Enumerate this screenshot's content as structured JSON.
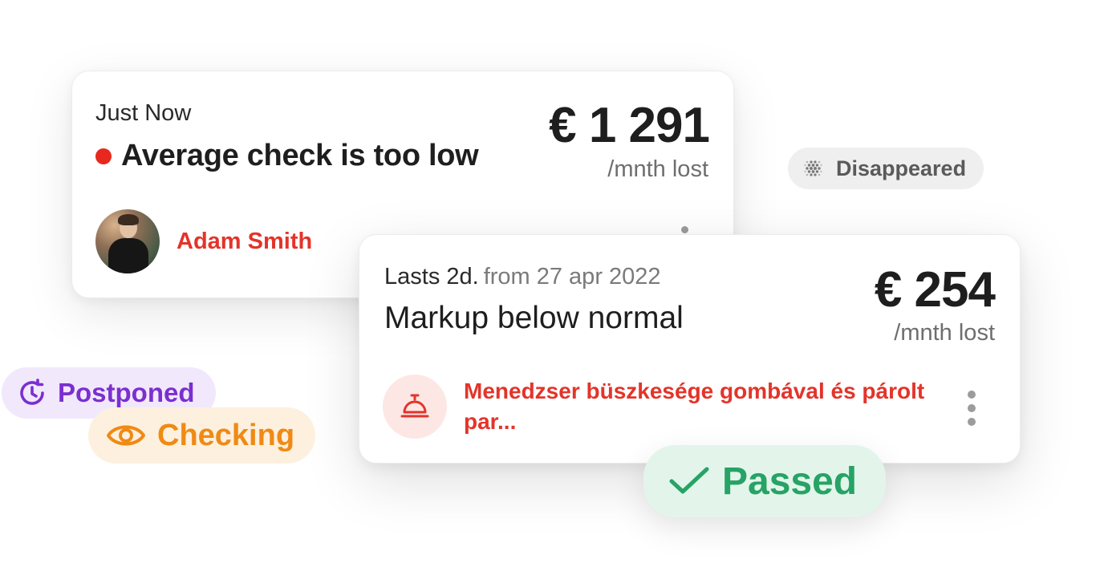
{
  "card1": {
    "time": "Just Now",
    "title": "Average check is too low",
    "amount": "€ 1 291",
    "amount_sub": "/mnth lost",
    "person_name": "Adam Smith"
  },
  "card2": {
    "duration": "Lasts 2d.",
    "from_date": "from 27 apr 2022",
    "title": "Markup below normal",
    "amount": "€ 254",
    "amount_sub": "/mnth lost",
    "dish_name": "Menedzser büszkesége gombával és párolt par..."
  },
  "statuses": {
    "disappeared": "Disappeared",
    "postponed": "Postponed",
    "checking": "Checking",
    "passed": "Passed"
  },
  "colors": {
    "alert_red": "#e3342a",
    "postponed_purple": "#7b2fd0",
    "checking_orange": "#ef8a15",
    "passed_green": "#26a365",
    "disappeared_gray": "#5a5a5a"
  },
  "icons": {
    "disappeared": "dots-fade-icon",
    "postponed": "clock-refresh-icon",
    "checking": "eye-icon",
    "passed": "checkmark-icon",
    "dish": "cloche-icon",
    "more": "kebab-menu-icon"
  }
}
